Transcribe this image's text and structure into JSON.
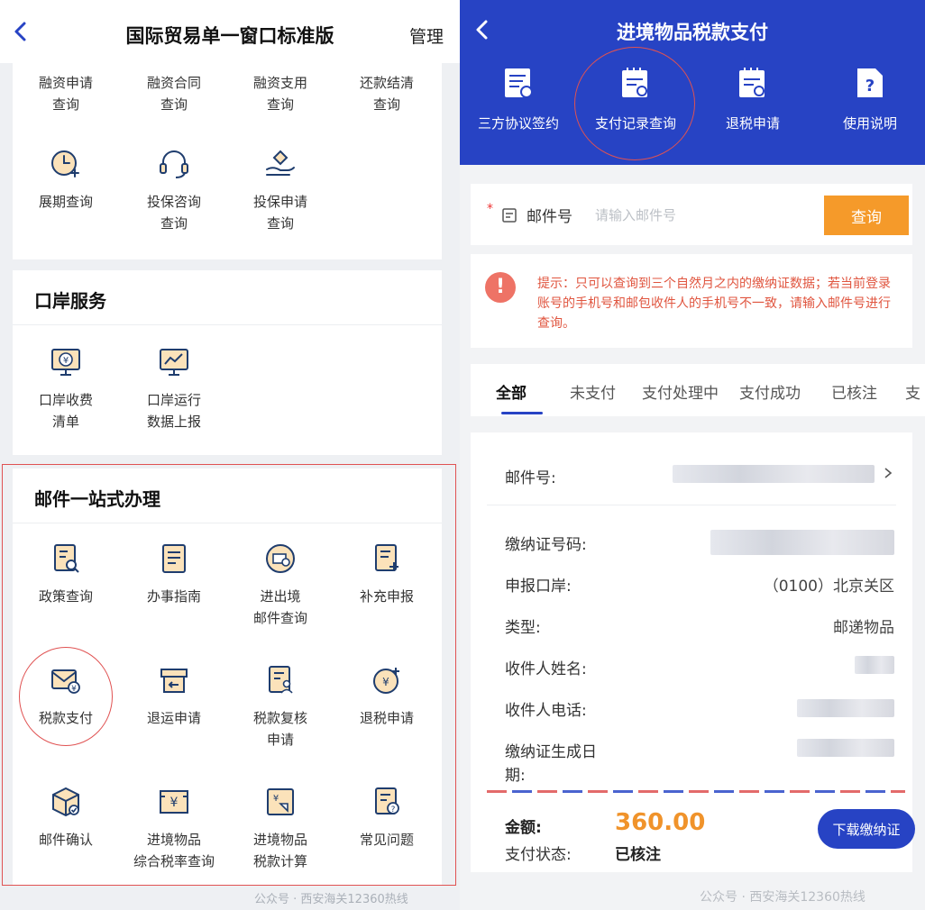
{
  "left": {
    "header": {
      "title": "国际贸易单一窗口标准版",
      "manage": "管理"
    },
    "finance_items": [
      {
        "l1": "融资申请",
        "l2": "查询",
        "icon": "none"
      },
      {
        "l1": "融资合同",
        "l2": "查询",
        "icon": "none"
      },
      {
        "l1": "融资支用",
        "l2": "查询",
        "icon": "none"
      },
      {
        "l1": "还款结清",
        "l2": "查询",
        "icon": "none"
      },
      {
        "l1": "展期查询",
        "l2": "",
        "icon": "clock-plus-icon"
      },
      {
        "l1": "投保咨询",
        "l2": "查询",
        "icon": "headset-icon"
      },
      {
        "l1": "投保申请",
        "l2": "查询",
        "icon": "hand-diamond-icon"
      }
    ],
    "port_section": {
      "title": "口岸服务",
      "items": [
        {
          "l1": "口岸收费",
          "l2": "清单",
          "icon": "yuan-monitor-icon"
        },
        {
          "l1": "口岸运行",
          "l2": "数据上报",
          "icon": "chart-monitor-icon"
        }
      ]
    },
    "mail_section": {
      "title": "邮件一站式办理",
      "items": [
        {
          "l1": "政策查询",
          "l2": "",
          "icon": "doc-search-icon"
        },
        {
          "l1": "办事指南",
          "l2": "",
          "icon": "doc-lines-icon"
        },
        {
          "l1": "进出境",
          "l2": "邮件查询",
          "icon": "mail-search-icon"
        },
        {
          "l1": "补充申报",
          "l2": "",
          "icon": "doc-plus-icon"
        },
        {
          "l1": "税款支付",
          "l2": "",
          "icon": "envelope-yuan-icon"
        },
        {
          "l1": "退运申请",
          "l2": "",
          "icon": "return-box-icon"
        },
        {
          "l1": "税款复核",
          "l2": "申请",
          "icon": "doc-person-icon"
        },
        {
          "l1": "退税申请",
          "l2": "",
          "icon": "refund-circle-icon"
        },
        {
          "l1": "邮件确认",
          "l2": "",
          "icon": "package-check-icon"
        },
        {
          "l1": "进境物品",
          "l2": "综合税率查询",
          "icon": "yuan-receipt-icon"
        },
        {
          "l1": "进境物品",
          "l2": "税款计算",
          "icon": "yuan-tag-icon"
        },
        {
          "l1": "常见问题",
          "l2": "",
          "icon": "doc-question-icon"
        }
      ]
    },
    "watermark": "公众号 · 西安海关12360热线"
  },
  "right": {
    "header": {
      "title": "进境物品税款支付"
    },
    "tools": [
      {
        "label": "三方协议签约",
        "icon": "agreement-doc-icon"
      },
      {
        "label": "支付记录查询",
        "icon": "calendar-search-icon"
      },
      {
        "label": "退税申请",
        "icon": "calendar-search-icon"
      },
      {
        "label": "使用说明",
        "icon": "doc-question-icon"
      }
    ],
    "search": {
      "required_mark": "*",
      "label": "邮件号",
      "placeholder": "请输入邮件号",
      "button": "查询"
    },
    "notice": "提示：只可以查询到三个自然月之内的缴纳证数据；若当前登录账号的手机号和邮包收件人的手机号不一致，请输入邮件号进行查询。",
    "tabs": [
      "全部",
      "未支付",
      "支付处理中",
      "支付成功",
      "已核注",
      "支"
    ],
    "active_tab": 0,
    "detail": {
      "mail_no_label": "邮件号:",
      "cert_no_label": "缴纳证号码:",
      "port_label": "申报口岸:",
      "port_value": "（0100）北京关区",
      "type_label": "类型:",
      "type_value": "邮递物品",
      "recipient_name_label": "收件人姓名:",
      "recipient_phone_label": "收件人电话:",
      "cert_date_label_1": "缴纳证生成日",
      "cert_date_label_2": "期:",
      "amount_label": "金额:",
      "amount_value": "360.00",
      "status_label": "支付状态:",
      "status_value": "已核注",
      "download_button": "下载缴纳证"
    },
    "watermark": "公众号 · 西安海关12360热线"
  },
  "colors": {
    "primary": "#2743c4",
    "accent": "#f59a2a",
    "warning": "#e0553f",
    "highlight": "#e05252"
  }
}
